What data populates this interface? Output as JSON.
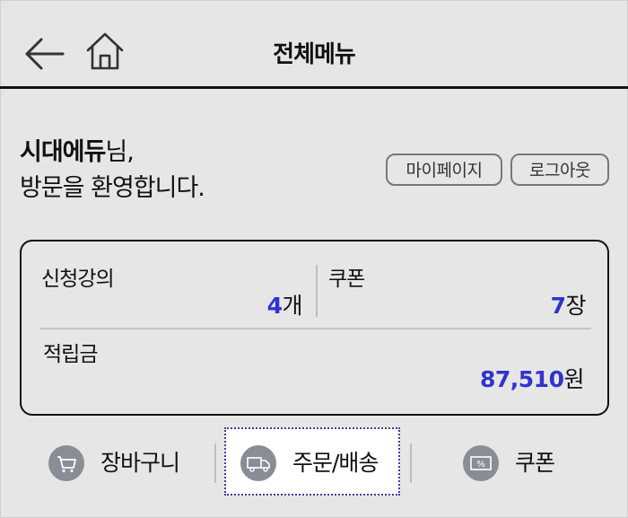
{
  "header": {
    "title": "전체메뉴",
    "back_icon": "back-arrow-icon",
    "home_icon": "home-icon"
  },
  "greeting": {
    "name": "시대에듀",
    "suffix": "님,",
    "line2": "방문을 환영합니다."
  },
  "buttons": {
    "mypage": "마이페이지",
    "logout": "로그아웃"
  },
  "stats": {
    "courses": {
      "label": "신청강의",
      "value": "4",
      "unit": "개"
    },
    "coupons": {
      "label": "쿠폰",
      "value": "7",
      "unit": "장"
    },
    "points": {
      "label": "적립금",
      "value": "87,510",
      "unit": "원"
    }
  },
  "menu": [
    {
      "label": "장바구니",
      "icon": "cart-icon"
    },
    {
      "label": "주문/배송",
      "icon": "truck-icon",
      "active": true
    },
    {
      "label": "쿠폰",
      "icon": "coupon-icon",
      "icon_text": "%"
    }
  ],
  "colors": {
    "background": "#e6e6e6",
    "accent": "#3333cc",
    "icon_circle": "#8a8d96",
    "focus_border": "#3b3ba8"
  }
}
